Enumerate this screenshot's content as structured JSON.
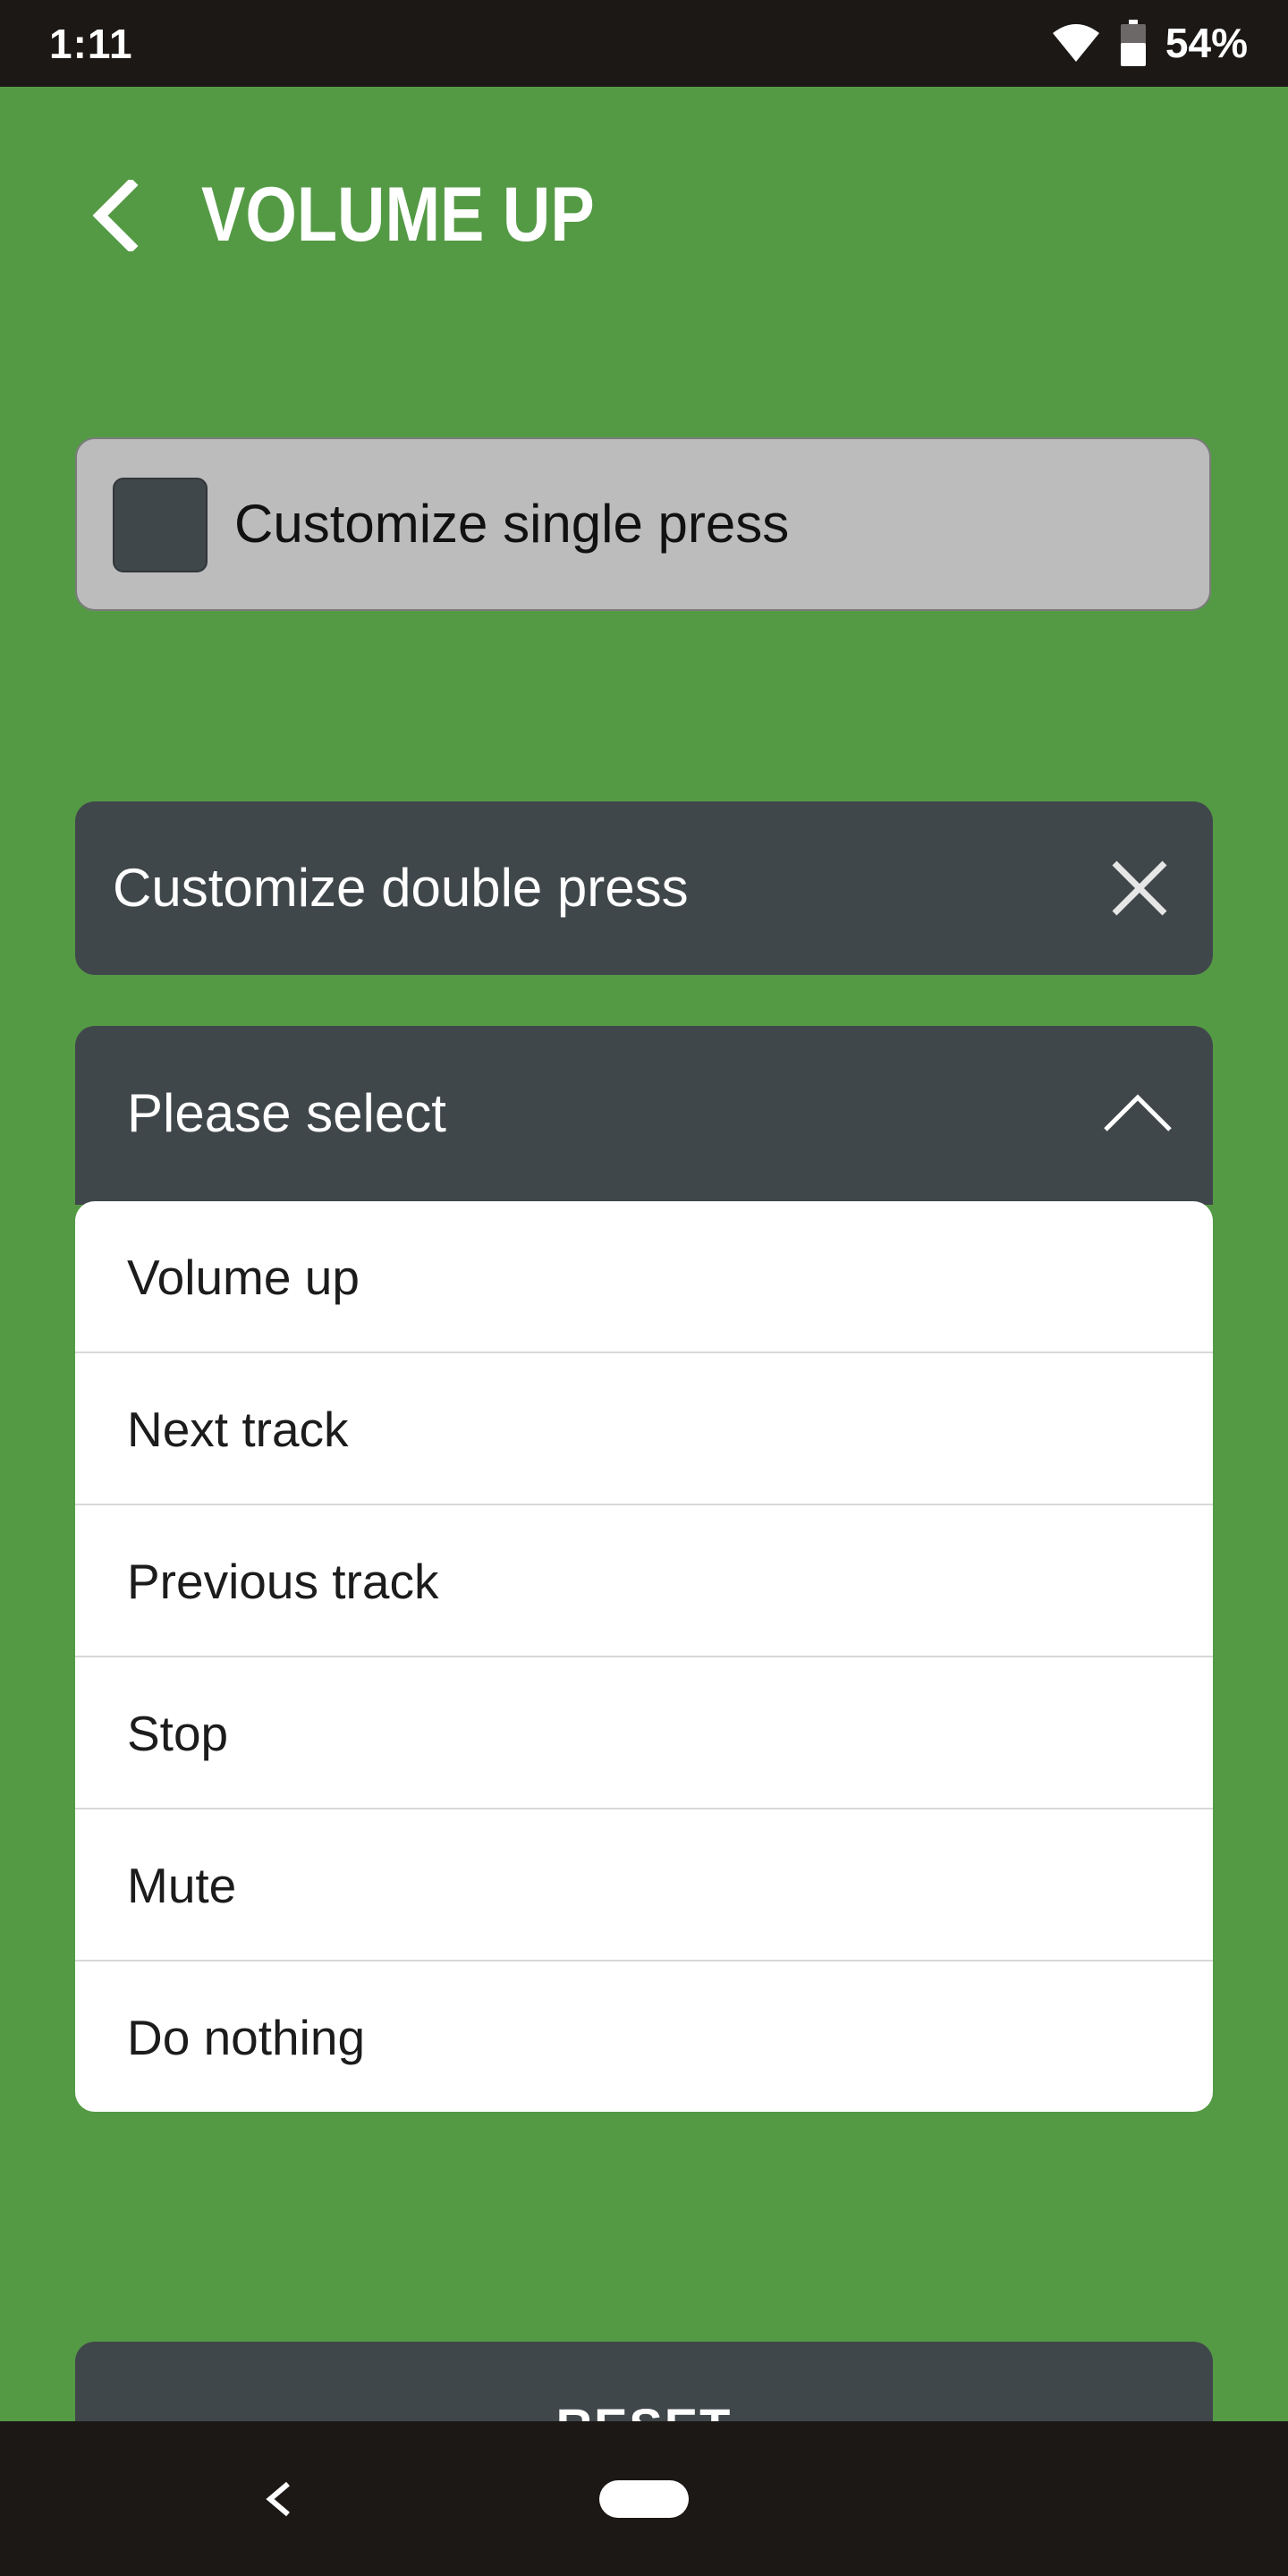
{
  "status_bar": {
    "time": "1:11",
    "battery_text": "54%",
    "icons": [
      "wifi-icon",
      "battery-icon"
    ]
  },
  "header": {
    "title": "VOLUME UP",
    "back_icon": "chevron-left-icon"
  },
  "single_press": {
    "label": "Customize single press",
    "checked": false
  },
  "double_press": {
    "label": "Customize double press",
    "close_icon": "close-icon"
  },
  "dropdown": {
    "placeholder": "Please select",
    "expanded": true,
    "toggle_icon": "chevron-up-icon",
    "options": [
      "Volume up",
      "Next track",
      "Previous track",
      "Stop",
      "Mute",
      "Do nothing"
    ]
  },
  "reset": {
    "label": "RESET"
  },
  "nav_bar": {
    "icons": [
      "back-icon",
      "home-pill-icon"
    ]
  },
  "colors": {
    "background": "#549a45",
    "panel_dark": "#40474b",
    "panel_light": "#bcbcbc",
    "system_bar": "#1c1816",
    "text_light": "#ffffff"
  }
}
